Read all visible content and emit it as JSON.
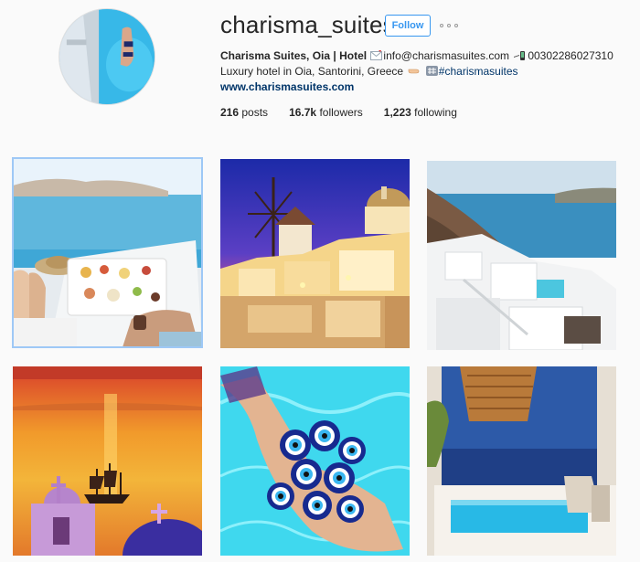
{
  "profile": {
    "username": "charisma_suites",
    "follow_label": "Follow",
    "bio_name": "Charisma Suites, Oia | Hotel",
    "email": "info@charismasuites.com",
    "phone": "00302286027310",
    "description": "Luxury hotel in Oia, Santorini, Greece",
    "hashtag": "#charismasuites",
    "website": "www.charismasuites.com"
  },
  "stats": [
    {
      "value": "216",
      "label": "posts"
    },
    {
      "value": "16.7k",
      "label": "followers"
    },
    {
      "value": "1,223",
      "label": "following"
    }
  ],
  "icons": {
    "email": "envelope-icon",
    "phone": "mobile-phone-icon",
    "hand": "pointing-hand-icon",
    "hashtag": "hashtag-box-icon",
    "more": "ellipsis-icon"
  },
  "colors": {
    "follow_accent": "#3897f0",
    "link": "#003569",
    "background": "#fafafa"
  },
  "posts": [
    {
      "subject": "breakfast tray by the pool with caldera view"
    },
    {
      "subject": "Oia windmill and domed church at twilight"
    },
    {
      "subject": "white cave houses over the caldera"
    },
    {
      "subject": "sunset sea with sailing ship and church crosses"
    },
    {
      "subject": "hand holding blue evil eye beads over pool water"
    },
    {
      "subject": "infinity pool under woven lamp at dusk"
    }
  ]
}
